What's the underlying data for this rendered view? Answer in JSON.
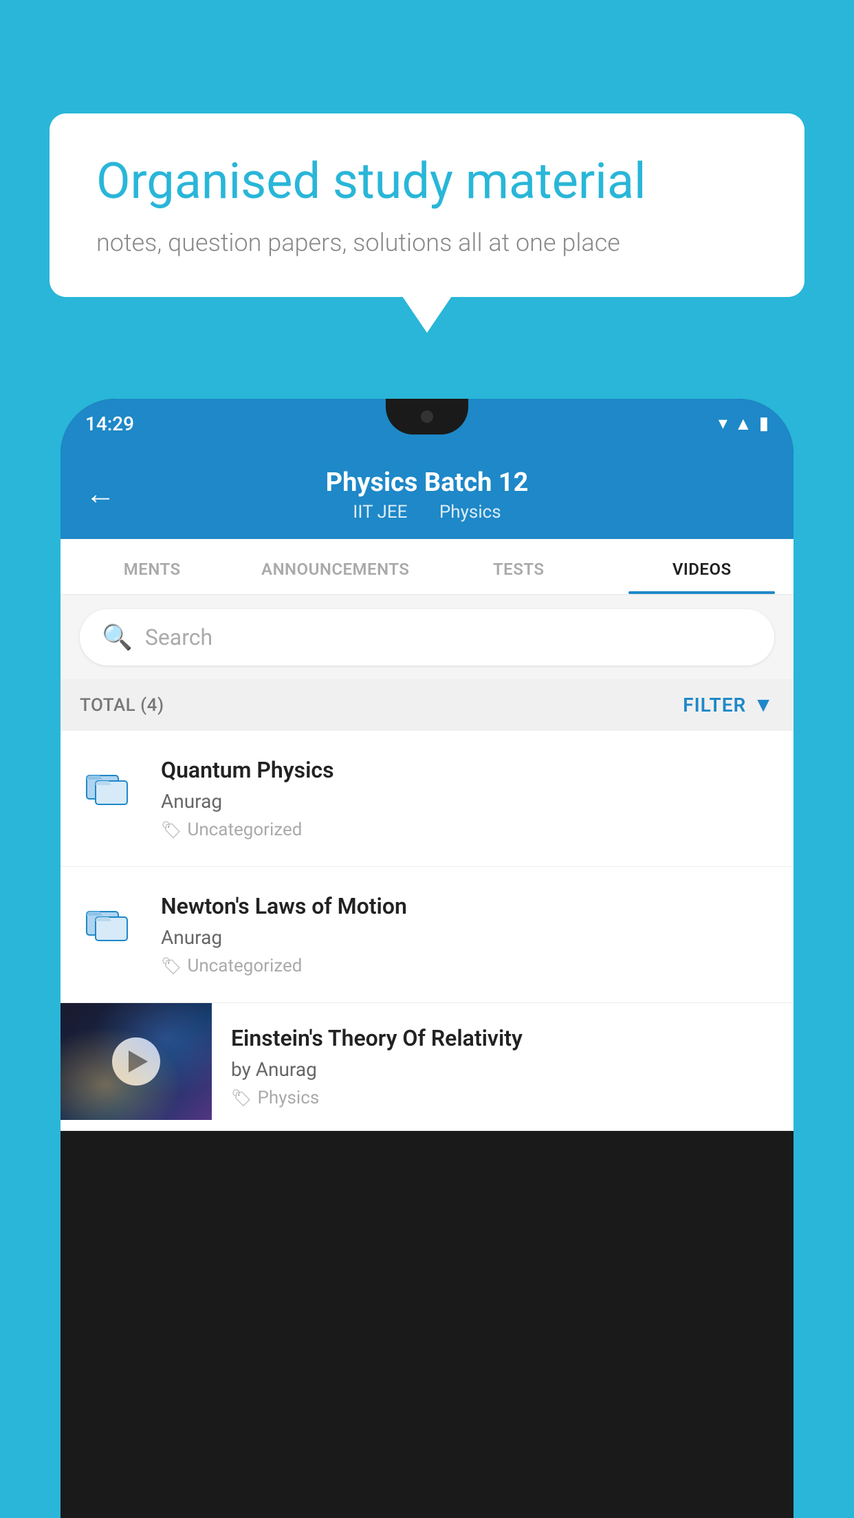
{
  "background_color": "#29b6d8",
  "speech_bubble": {
    "heading": "Organised study material",
    "subtext": "notes, question papers, solutions all at one place"
  },
  "status_bar": {
    "time": "14:29",
    "icons": [
      "wifi",
      "signal",
      "battery"
    ]
  },
  "app_header": {
    "title": "Physics Batch 12",
    "subtitle_left": "IIT JEE",
    "subtitle_right": "Physics",
    "back_label": "←"
  },
  "tabs": [
    {
      "label": "MENTS",
      "active": false
    },
    {
      "label": "ANNOUNCEMENTS",
      "active": false
    },
    {
      "label": "TESTS",
      "active": false
    },
    {
      "label": "VIDEOS",
      "active": true
    }
  ],
  "search": {
    "placeholder": "Search"
  },
  "filter_bar": {
    "total_label": "TOTAL (4)",
    "filter_label": "FILTER"
  },
  "video_items": [
    {
      "title": "Quantum Physics",
      "author": "Anurag",
      "tag": "Uncategorized",
      "has_thumb": false
    },
    {
      "title": "Newton's Laws of Motion",
      "author": "Anurag",
      "tag": "Uncategorized",
      "has_thumb": false
    },
    {
      "title": "Einstein's Theory Of Relativity",
      "author": "by Anurag",
      "tag": "Physics",
      "has_thumb": true
    }
  ]
}
